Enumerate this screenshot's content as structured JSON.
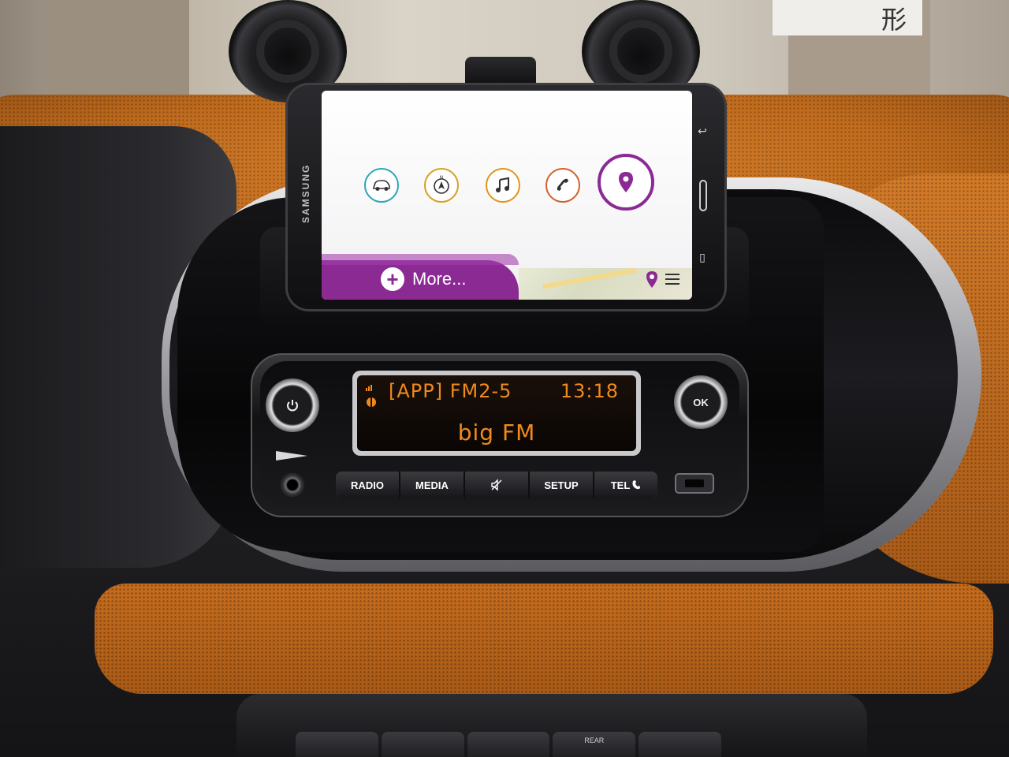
{
  "phone": {
    "brand": "SAMSUNG",
    "apps": [
      {
        "name": "car",
        "color": "#2aa7b5"
      },
      {
        "name": "compass",
        "color": "#d7a020"
      },
      {
        "name": "music",
        "color": "#e0961a"
      },
      {
        "name": "phone",
        "color": "#d2602c"
      },
      {
        "name": "location",
        "color": "#8b2a93"
      }
    ],
    "more_label": "More...",
    "accent": "#8b2a93"
  },
  "radio": {
    "display_top": "[APP] FM2-5",
    "display_time": "13:18",
    "display_station": "big FM",
    "lcd_color": "#f18a1c",
    "power_icon": "power-icon",
    "ok_label": "OK",
    "buttons": [
      {
        "label": "RADIO"
      },
      {
        "label": "MEDIA"
      },
      {
        "label": "",
        "icon": "mute-icon"
      },
      {
        "label": "SETUP"
      },
      {
        "label": "TEL"
      }
    ]
  },
  "street_sign_char": "形",
  "climate": {
    "rear_label": "REAR"
  }
}
